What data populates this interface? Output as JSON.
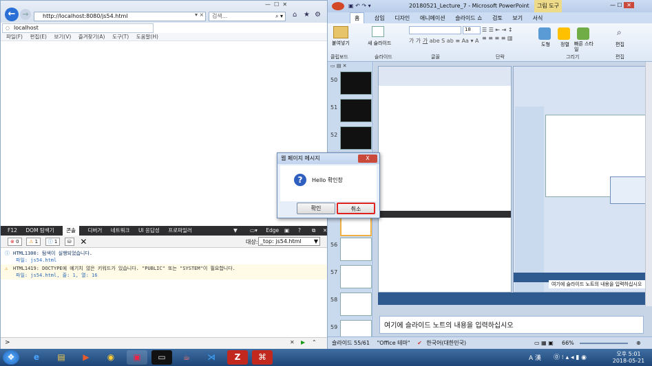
{
  "ie": {
    "url": "http://localhost:8080/js54.html",
    "search_placeholder": "검색...",
    "tab_title": "localhost",
    "menu": [
      "파일(F)",
      "편집(E)",
      "보기(V)",
      "즐겨찾기(A)",
      "도구(T)",
      "도움말(H)"
    ]
  },
  "devtools": {
    "tabs": [
      "F12",
      "DOM 탐색기",
      "콘솔",
      "디버거",
      "네트워크",
      "UI 응답성",
      "프로파일러"
    ],
    "mode": "Edge",
    "counts": {
      "errors": "0",
      "warnings": "1",
      "messages": "1"
    },
    "target_label": "대상:",
    "target_value": "_top: js54.html",
    "messages": [
      {
        "code": "HTML1300: 탐색이 실행되었습니다.",
        "detail": "파일: js54.html",
        "type": "info"
      },
      {
        "code": "HTML1419: DOCTYPE에 예기치 않은 키워드가 있습니다. \"PUBLIC\" 또는 \"SYSTEM\"이 필요합니다.",
        "detail": "파일: js54.html, 줄: 1, 열: 16",
        "type": "warning"
      }
    ]
  },
  "ppt": {
    "title": "20180521_Lecture_7 - Microsoft PowerPoint",
    "tool_tab": "그림 도구",
    "tabs": [
      "홈",
      "삽입",
      "디자인",
      "애니메이션",
      "슬라이드 쇼",
      "검토",
      "보기",
      "서식"
    ],
    "groups": [
      "클립보드",
      "슬라이드",
      "글꼴",
      "단락",
      "그리기",
      "편집"
    ],
    "buttons": {
      "paste": "붙여넣기",
      "new_slide": "새 슬라이드",
      "shape": "도형",
      "arrange": "정렬",
      "quick_style": "빠른 스타일",
      "edit": "편집"
    },
    "font_size": "18",
    "thumb_numbers": [
      "50",
      "51",
      "52",
      "56",
      "57",
      "58",
      "59"
    ],
    "notes": "여기에 슬라이드 노트의 내용을 입력하십시오",
    "status": {
      "slide": "슬라이드 55/61",
      "theme": "\"Office 테마\"",
      "lang": "한국어(대한민국)",
      "zoom": "66%"
    }
  },
  "dialog": {
    "title": "웹 페이지 메시지",
    "message": "Hello 확인창",
    "ok": "확인",
    "cancel": "취소",
    "close": "X"
  },
  "taskbar": {
    "time": "오후 5:01",
    "date": "2018-05-21",
    "ime": "A 漢"
  }
}
